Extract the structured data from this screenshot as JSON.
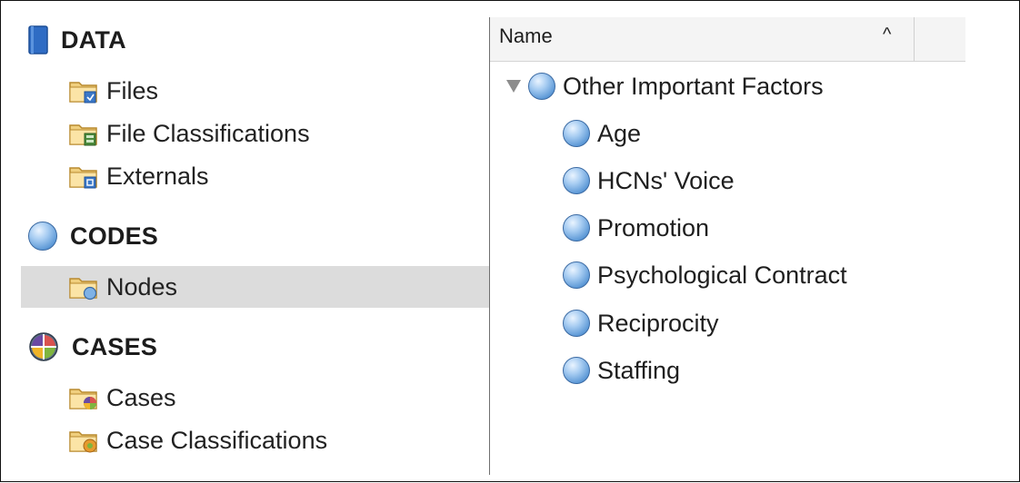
{
  "sidebar": {
    "data_section": "DATA",
    "data_items": [
      {
        "label": "Files",
        "icon": "folder-file-icon"
      },
      {
        "label": "File Classifications",
        "icon": "folder-classification-icon"
      },
      {
        "label": "Externals",
        "icon": "folder-external-icon"
      }
    ],
    "codes_section": "CODES",
    "codes_items": [
      {
        "label": "Nodes",
        "icon": "folder-node-icon",
        "selected": true
      }
    ],
    "cases_section": "CASES",
    "cases_items": [
      {
        "label": "Cases",
        "icon": "folder-case-icon"
      },
      {
        "label": "Case Classifications",
        "icon": "folder-case-classification-icon"
      }
    ]
  },
  "list": {
    "column_header": "Name",
    "sort_indicator": "^",
    "parent": {
      "label": "Other Important Factors",
      "expanded": true
    },
    "children": [
      "Age",
      "HCNs' Voice",
      "Promotion",
      "Psychological Contract",
      "Reciprocity",
      "Staffing"
    ]
  },
  "colors": {
    "selected_row": "#dcdcdc",
    "node_blue": "#5c98d6",
    "folder_tan": "#f0cf7e"
  }
}
